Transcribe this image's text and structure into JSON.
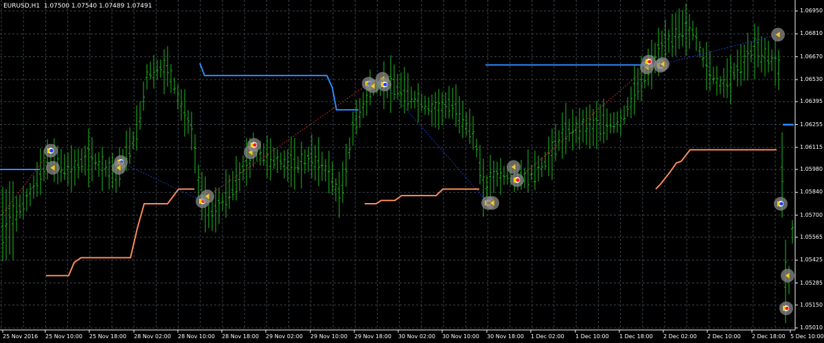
{
  "header": {
    "symbol": "EURUSD,H1",
    "ohlc": "1.07500 1.07540 1.07489 1.07491"
  },
  "colors": {
    "background": "#000000",
    "grid": "#3c4650",
    "candles": "#1fbf1f",
    "resistance": "#2e8bff",
    "support": "#ff8c5a",
    "trend_up": "#c0302a",
    "trend_down": "#1a40d0",
    "axis": "#ffffff"
  },
  "price_axis": {
    "labels": [
      "1.06950",
      "1.06810",
      "1.06670",
      "1.06530",
      "1.06395",
      "1.06255",
      "1.06115",
      "1.05980",
      "1.05840",
      "1.05700",
      "1.05565",
      "1.05425",
      "1.05285",
      "1.05150",
      "1.05010"
    ]
  },
  "time_axis": {
    "labels": [
      "25 Nov 2016",
      "25 Nov 10:00",
      "25 Nov 18:00",
      "28 Nov 02:00",
      "28 Nov 10:00",
      "28 Nov 18:00",
      "29 Nov 02:00",
      "29 Nov 10:00",
      "29 Nov 18:00",
      "30 Nov 02:00",
      "30 Nov 10:00",
      "30 Nov 18:00",
      "1 Dec 02:00",
      "1 Dec 10:00",
      "1 Dec 18:00",
      "2 Dec 02:00",
      "2 Dec 10:00",
      "2 Dec 18:00",
      "5 Dec 10:00"
    ]
  },
  "chart_data": {
    "type": "candlestick",
    "symbol": "EURUSD",
    "timeframe": "H1",
    "ylim": [
      1.0501,
      1.0702
    ],
    "last_price": 1.06255,
    "resistance_segments": [
      [
        [
          1.0598,
          0
        ],
        [
          1.0598,
          58
        ]
      ],
      [
        [
          1.0663,
          291
        ],
        [
          1.06555,
          298
        ],
        [
          1.06555,
          476
        ],
        [
          1.0648,
          484
        ],
        [
          1.06345,
          490
        ],
        [
          1.06345,
          522
        ]
      ],
      [
        [
          1.0662,
          707
        ],
        [
          1.0662,
          940
        ]
      ],
      [
        [
          1.06255,
          1140
        ],
        [
          1.06255,
          1155
        ]
      ]
    ],
    "support_segments": [
      [
        [
          1.0533,
          67
        ],
        [
          1.0533,
          100
        ],
        [
          1.0541,
          108
        ],
        [
          1.0544,
          118
        ],
        [
          1.0544,
          190
        ],
        [
          1.0562,
          200
        ],
        [
          1.0577,
          210
        ],
        [
          1.0577,
          244
        ],
        [
          1.0586,
          260
        ],
        [
          1.0586,
          283
        ]
      ],
      [
        [
          1.0577,
          531
        ],
        [
          1.0577,
          548
        ],
        [
          1.0579,
          555
        ],
        [
          1.0579,
          575
        ],
        [
          1.0582,
          585
        ],
        [
          1.0582,
          635
        ],
        [
          1.0586,
          645
        ],
        [
          1.0586,
          698
        ]
      ],
      [
        [
          1.0586,
          955
        ],
        [
          1.0589,
          962
        ],
        [
          1.0596,
          975
        ],
        [
          1.0602,
          985
        ],
        [
          1.0603,
          992
        ],
        [
          1.061,
          1005
        ],
        [
          1.061,
          1131
        ]
      ]
    ],
    "markers": [
      {
        "x": 74,
        "price": 1.06095,
        "kind": "buy"
      },
      {
        "x": 77,
        "price": 1.0599,
        "kind": "close"
      },
      {
        "x": 176,
        "price": 1.06025,
        "kind": "buy"
      },
      {
        "x": 173,
        "price": 1.0599,
        "kind": "close"
      },
      {
        "x": 295,
        "price": 1.05785,
        "kind": "sell"
      },
      {
        "x": 302,
        "price": 1.05815,
        "kind": "close"
      },
      {
        "x": 365,
        "price": 1.06085,
        "kind": "close"
      },
      {
        "x": 370,
        "price": 1.0613,
        "kind": "sell"
      },
      {
        "x": 537,
        "price": 1.06505,
        "kind": "buy"
      },
      {
        "x": 543,
        "price": 1.0649,
        "kind": "close"
      },
      {
        "x": 557,
        "price": 1.06535,
        "kind": "close"
      },
      {
        "x": 560,
        "price": 1.065,
        "kind": "buy"
      },
      {
        "x": 711,
        "price": 1.05775,
        "kind": "sell"
      },
      {
        "x": 717,
        "price": 1.05775,
        "kind": "close"
      },
      {
        "x": 748,
        "price": 1.05995,
        "kind": "close"
      },
      {
        "x": 753,
        "price": 1.05915,
        "kind": "sell"
      },
      {
        "x": 942,
        "price": 1.06605,
        "kind": "close"
      },
      {
        "x": 945,
        "price": 1.0664,
        "kind": "sell"
      },
      {
        "x": 962,
        "price": 1.06615,
        "kind": "buy"
      },
      {
        "x": 965,
        "price": 1.06625,
        "kind": "close"
      },
      {
        "x": 1133,
        "price": 1.06805,
        "kind": "close"
      },
      {
        "x": 1137,
        "price": 1.0577,
        "kind": "buy"
      },
      {
        "x": 1147,
        "price": 1.0533,
        "kind": "close"
      },
      {
        "x": 1145,
        "price": 1.0513,
        "kind": "sell"
      }
    ]
  }
}
